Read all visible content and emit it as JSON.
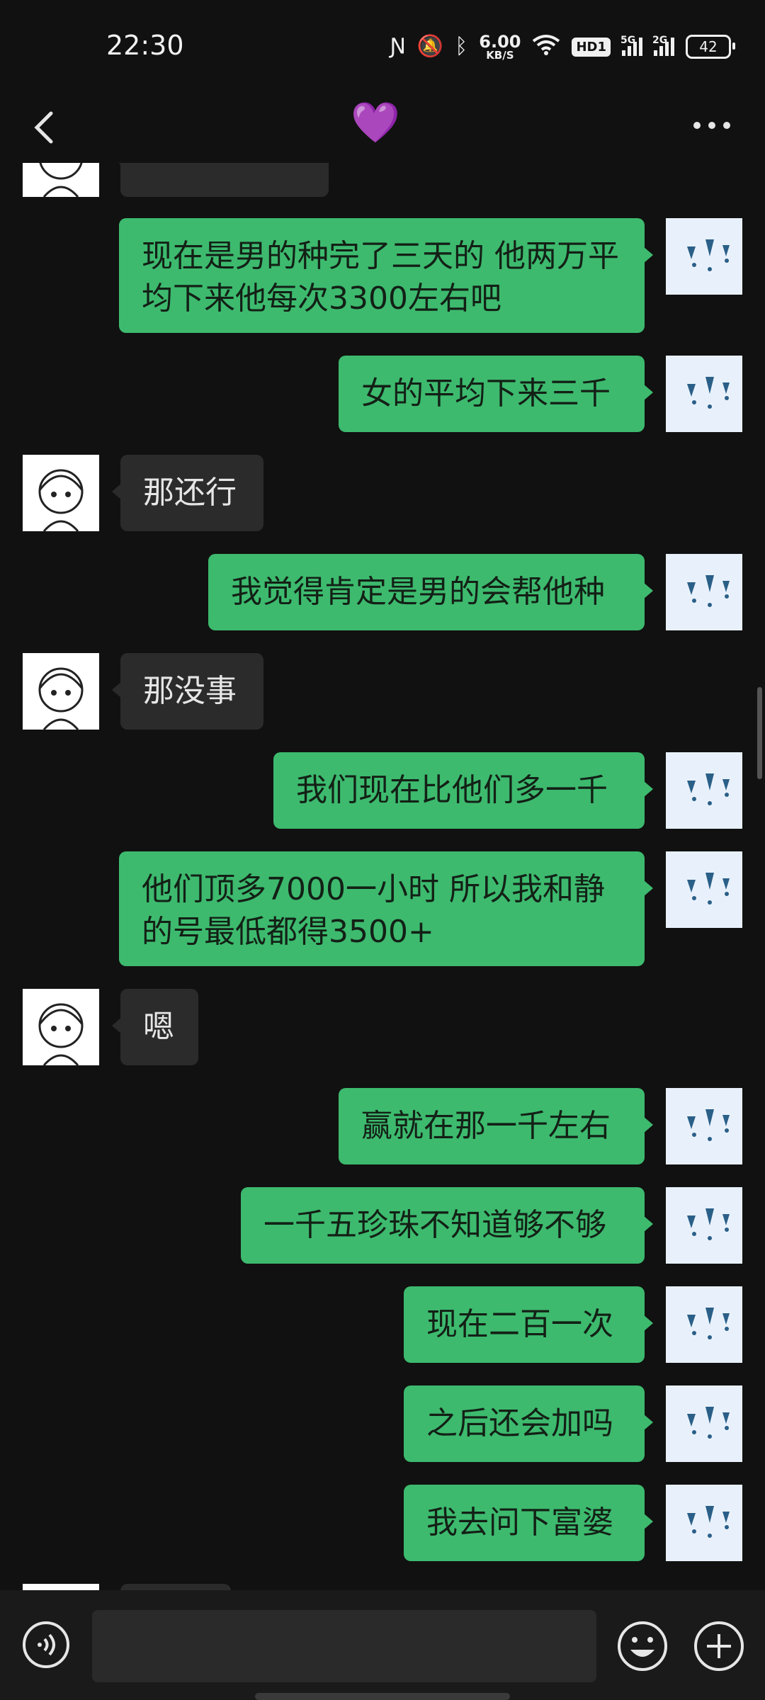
{
  "status_bar": {
    "time": "22:30",
    "net_speed_value": "6.00",
    "net_speed_unit": "KB/S",
    "hd_label": "HD1",
    "signal1_label": "5G",
    "signal2_label": "2G",
    "battery": "42"
  },
  "header": {
    "title_icon": "purple-heart"
  },
  "messages": [
    {
      "side": "left",
      "text": ""
    },
    {
      "side": "right",
      "text": "现在是男的种完了三天的 他两万平均下来他每次3300左右吧"
    },
    {
      "side": "right",
      "text": "女的平均下来三千"
    },
    {
      "side": "left",
      "text": "那还行"
    },
    {
      "side": "right",
      "text": "我觉得肯定是男的会帮他种"
    },
    {
      "side": "left",
      "text": "那没事"
    },
    {
      "side": "right",
      "text": "我们现在比他们多一千"
    },
    {
      "side": "right",
      "text": "他们顶多7000一小时 所以我和静的号最低都得3500+"
    },
    {
      "side": "left",
      "text": "嗯"
    },
    {
      "side": "right",
      "text": "赢就在那一千左右"
    },
    {
      "side": "right",
      "text": "一千五珍珠不知道够不够"
    },
    {
      "side": "right",
      "text": "现在二百一次"
    },
    {
      "side": "right",
      "text": "之后还会加吗"
    },
    {
      "side": "right",
      "text": "我去问下富婆"
    }
  ],
  "bottom_bar": {
    "input_value": "",
    "icons": [
      "voice-icon",
      "emoji-icon",
      "plus-icon"
    ]
  },
  "colors": {
    "background": "#111111",
    "my_bubble": "#3dba6e",
    "other_bubble": "#2b2b2b"
  }
}
